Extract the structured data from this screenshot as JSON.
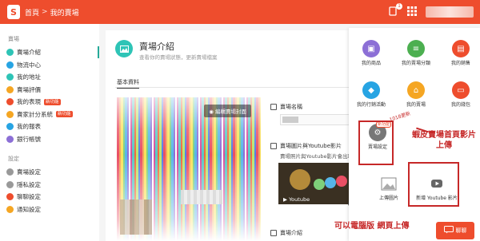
{
  "topbar": {
    "logo": "S",
    "breadcrumb_home": "首頁",
    "breadcrumb_sep": ">",
    "breadcrumb_current": "我的賣場",
    "notification_count": "1"
  },
  "sidebar": {
    "section1_title": "賣場",
    "items": [
      {
        "label": "賣場介紹",
        "color": "#2ec4b6",
        "tag": ""
      },
      {
        "label": "物流中心",
        "color": "#27a4e3",
        "tag": ""
      },
      {
        "label": "我的地址",
        "color": "#2ec4b6",
        "tag": ""
      },
      {
        "label": "賣場評價",
        "color": "#f5a623",
        "tag": ""
      },
      {
        "label": "我的表現",
        "color": "#ee4d2d",
        "tag": "新功能"
      },
      {
        "label": "賣家計分系統",
        "color": "#f5a623",
        "tag": "新功能"
      },
      {
        "label": "我的報表",
        "color": "#27a4e3",
        "tag": ""
      },
      {
        "label": "銀行帳號",
        "color": "#8c6fd6",
        "tag": ""
      }
    ],
    "section2_title": "設定",
    "settings": [
      {
        "label": "賣場設定",
        "color": "#999999"
      },
      {
        "label": "隱私設定",
        "color": "#999999"
      },
      {
        "label": "聊聊設定",
        "color": "#ee4d2d"
      },
      {
        "label": "通知設定",
        "color": "#f5a623"
      }
    ]
  },
  "main": {
    "title": "賣場介紹",
    "subtitle": "查看你的賣場狀態，更新賣場檔案",
    "tab": "基本資料",
    "cover_button": "編輯賣場封面",
    "field_name_label": "賣場名稱",
    "field_media_label": "賣場圖片與Youtube影片",
    "field_media_hint": "賣場照片與Youtube影片會出現",
    "youtube_label": "Youtube",
    "field_intro_label": "賣場介紹"
  },
  "panel": {
    "apps": [
      {
        "label": "我的商品",
        "color": "#8c6fd6",
        "icon": "box-icon"
      },
      {
        "label": "我的賣場分類",
        "color": "#4caf50",
        "icon": "list-icon"
      },
      {
        "label": "我的銷售",
        "color": "#ee4d2d",
        "icon": "receipt-icon"
      },
      {
        "label": "我的行銷活動",
        "color": "#27a4e3",
        "icon": "megaphone-icon"
      },
      {
        "label": "我的賣場",
        "color": "#f5a623",
        "icon": "shop-icon"
      },
      {
        "label": "我的錢包",
        "color": "#ee4d2d",
        "icon": "wallet-icon"
      },
      {
        "label": "賣場設定",
        "color": "#777777",
        "icon": "gear-icon"
      }
    ],
    "new_tag": "新功能",
    "upload_image_label": "上傳圖片",
    "new_youtube_label": "新增 Youtube 影片"
  },
  "annotations": {
    "handwritten_note": "1018更新",
    "callout1": "蝦皮賣場首頁影片上傳",
    "callout2": "可以電腦版 網頁上傳"
  },
  "chat": {
    "label": "聊聊"
  }
}
